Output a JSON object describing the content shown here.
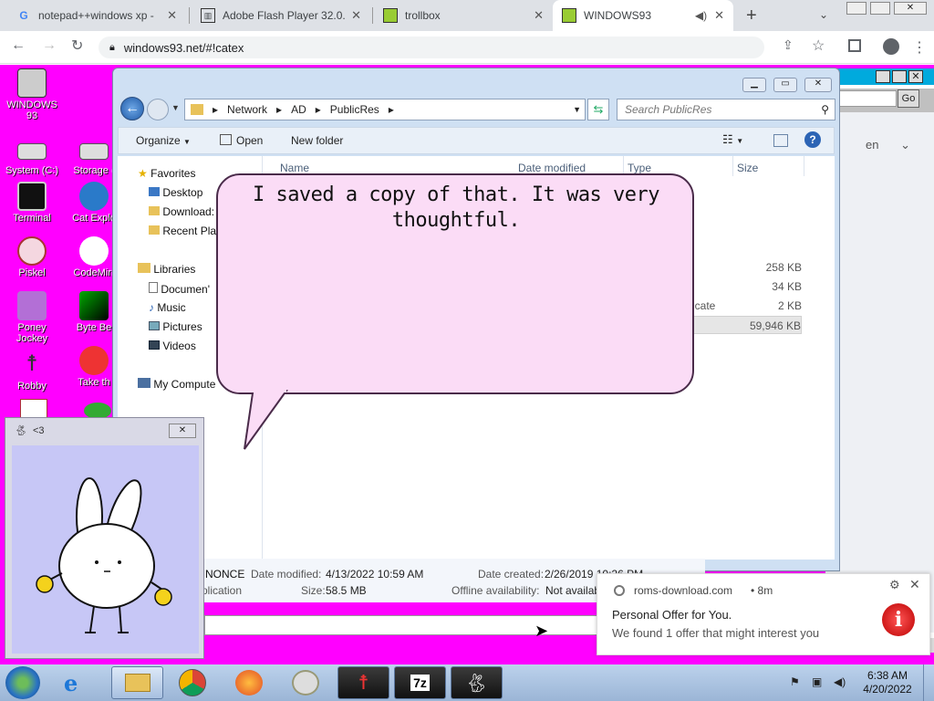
{
  "browser": {
    "tabs": [
      {
        "title": "notepad++windows xp -",
        "icon": "google-icon"
      },
      {
        "title": "Adobe Flash Player 32.0.",
        "icon": "archive-icon"
      },
      {
        "title": "trollbox",
        "icon": "film-icon"
      },
      {
        "title": "WINDOWS93",
        "icon": "film-icon"
      }
    ],
    "url": "windows93.net/#!catex"
  },
  "desktop": {
    "icons": [
      {
        "label": "WINDOWS 93"
      },
      {
        "label": "System (C:)"
      },
      {
        "label": "Storage ("
      },
      {
        "label": "Terminal"
      },
      {
        "label": "Cat Explo"
      },
      {
        "label": "Piskel"
      },
      {
        "label": "CodeMirr"
      },
      {
        "label": "Poney Jockey"
      },
      {
        "label": "Byte Be"
      },
      {
        "label": "Robby"
      },
      {
        "label": "Take th"
      }
    ]
  },
  "backwin": {
    "go": "Go",
    "lang": "en"
  },
  "explorer": {
    "path": [
      "Network",
      "AD",
      "PublicRes"
    ],
    "search_placeholder": "Search PublicRes",
    "cmd": {
      "organize": "Organize",
      "open": "Open",
      "new_folder": "New folder"
    },
    "nav": {
      "favorites": "Favorites",
      "desktop": "Desktop",
      "downloads": "Download:",
      "recent": "Recent Pla",
      "libraries": "Libraries",
      "documents": "Documen'",
      "music": "Music",
      "pictures": "Pictures",
      "videos": "Videos",
      "computer": "My Compute"
    },
    "columns": {
      "name": "Name",
      "date": "Date modified",
      "type": "Type",
      "size": "Size"
    },
    "rows": [
      {
        "type": "",
        "size": "258 KB"
      },
      {
        "type": "",
        "size": "34 KB"
      },
      {
        "type": "icate",
        "size": "2 KB"
      },
      {
        "type": "",
        "size": "59,946 KB"
      }
    ],
    "details": {
      "name": "NONCE",
      "date_modified_label": "Date modified:",
      "date_modified": "4/13/2022 10:59 AM",
      "date_created_label": "Date created:",
      "date_created": "2/26/2019 10:26 PM",
      "type": "plication",
      "size_label": "Size:",
      "size": "58.5 MB",
      "offline_label": "Offline availability:",
      "offline": "Not availab"
    }
  },
  "bubble": {
    "text": "I saved a copy of that. It was very thoughtful."
  },
  "bunny": {
    "title": "<3"
  },
  "notification": {
    "source": "roms-download.com",
    "age": "• 8m",
    "title": "Personal Offer for You.",
    "body": "We found 1 offer that might interest you"
  },
  "taskbar": {
    "time": "6:38 AM",
    "date": "4/20/2022"
  }
}
